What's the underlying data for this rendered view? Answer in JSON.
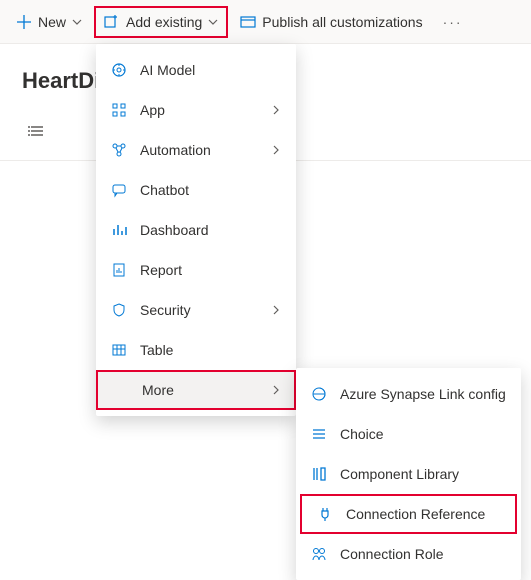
{
  "toolbar": {
    "new_label": "New",
    "add_existing_label": "Add existing",
    "publish_label": "Publish all customizations"
  },
  "page": {
    "title": "HeartDise"
  },
  "menu1": {
    "items": [
      {
        "label": "AI Model",
        "icon": "ai-model-icon",
        "sub": false
      },
      {
        "label": "App",
        "icon": "app-icon",
        "sub": true
      },
      {
        "label": "Automation",
        "icon": "automation-icon",
        "sub": true
      },
      {
        "label": "Chatbot",
        "icon": "chatbot-icon",
        "sub": false
      },
      {
        "label": "Dashboard",
        "icon": "dashboard-icon",
        "sub": false
      },
      {
        "label": "Report",
        "icon": "report-icon",
        "sub": false
      },
      {
        "label": "Security",
        "icon": "security-icon",
        "sub": true
      },
      {
        "label": "Table",
        "icon": "table-icon",
        "sub": false
      }
    ],
    "more_label": "More"
  },
  "menu2": {
    "items": [
      {
        "label": "Azure Synapse Link config",
        "icon": "synapse-icon"
      },
      {
        "label": "Choice",
        "icon": "choice-icon"
      },
      {
        "label": "Component Library",
        "icon": "component-library-icon"
      },
      {
        "label": "Connection Reference",
        "icon": "connection-ref-icon"
      },
      {
        "label": "Connection Role",
        "icon": "connection-role-icon"
      }
    ]
  }
}
